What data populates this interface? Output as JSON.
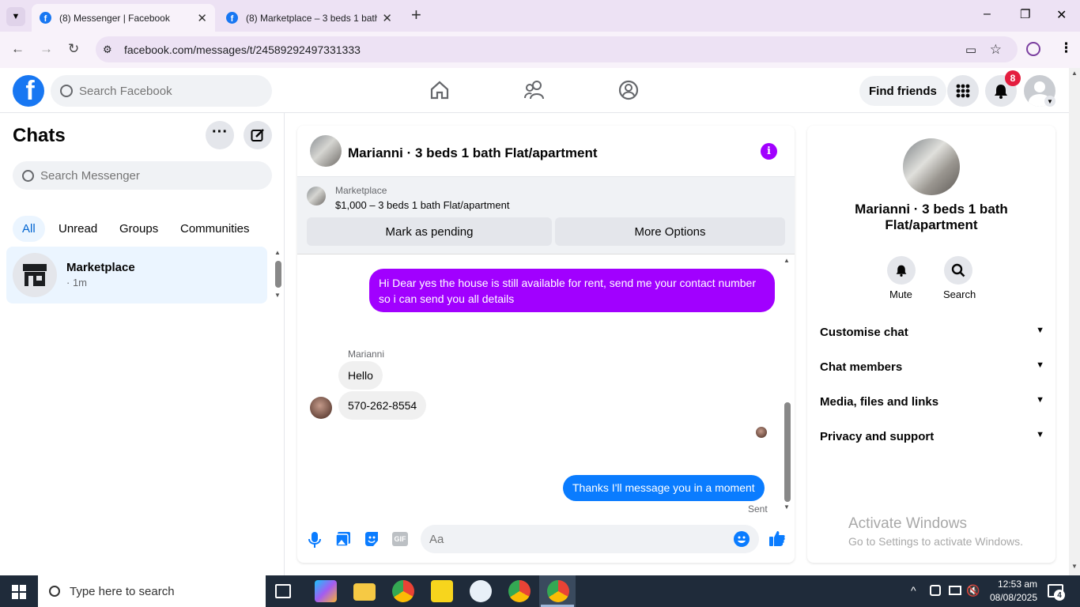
{
  "browser": {
    "tabs": [
      {
        "title": "(8) Messenger | Facebook",
        "active": true
      },
      {
        "title": "(8) Marketplace – 3 beds 1 bath",
        "active": false
      }
    ],
    "url": "facebook.com/messages/t/24589292497331333",
    "new_tab": "+",
    "minimize": "–",
    "maximize": "❐",
    "close": "✕"
  },
  "fb": {
    "logo": "f",
    "search_placeholder": "Search Facebook",
    "find_friends": "Find friends",
    "notif_count": "8"
  },
  "chats": {
    "title": "Chats",
    "search_placeholder": "Search Messenger",
    "filters": [
      "All",
      "Unread",
      "Groups",
      "Communities"
    ],
    "items": [
      {
        "name": "Marketplace",
        "time": "· 1m"
      }
    ]
  },
  "conversation": {
    "title": "Marianni · 3 beds 1 bath Flat/apartment",
    "listing": {
      "source": "Marketplace",
      "price_title": "$1,000 – 3 beds 1 bath Flat/apartment"
    },
    "mark_pending": "Mark as pending",
    "more_options": "More Options",
    "messages": [
      {
        "from": "me",
        "text": "Hi Dear yes the house is still available for rent, send me your contact number so i can send you all details"
      },
      {
        "from": "them",
        "sender": "Marianni",
        "text": "Hello"
      },
      {
        "from": "them",
        "text": "570-262-8554"
      },
      {
        "from": "me",
        "text": "Thanks I'll message you in a moment"
      }
    ],
    "status": "Sent",
    "composer_placeholder": "Aa"
  },
  "info": {
    "name": "Marianni · 3 beds 1 bath Flat/apartment",
    "actions": [
      "Mute",
      "Search"
    ],
    "sections": [
      "Customise chat",
      "Chat members",
      "Media, files and links",
      "Privacy and support"
    ]
  },
  "watermark": {
    "line1": "Activate Windows",
    "line2": "Go to Settings to activate Windows."
  },
  "taskbar": {
    "search": "Type here to search",
    "time": "12:53 am",
    "date": "08/08/2025",
    "notif": "4"
  },
  "colors": {
    "fb_blue": "#1877f2",
    "chat_purple": "#a100ff",
    "msg_blue": "#0a7cff",
    "tab_bg": "#ede2f4"
  }
}
